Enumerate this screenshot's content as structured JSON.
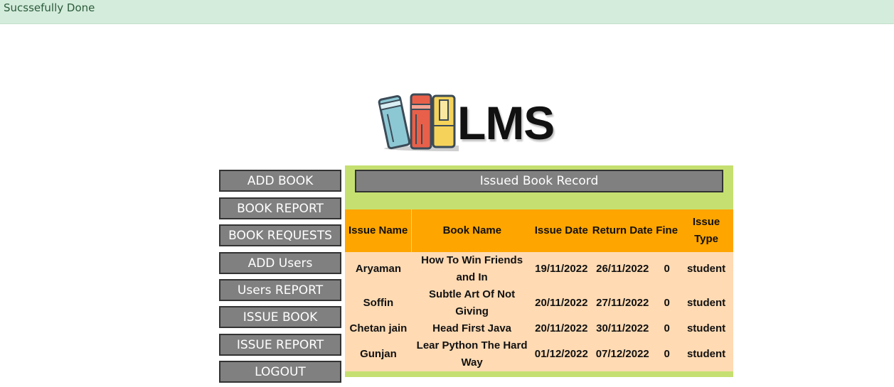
{
  "alert": {
    "message": "Sucssefully Done"
  },
  "logo": {
    "text": "LMS"
  },
  "sidebar": {
    "items": [
      {
        "label": "ADD BOOK"
      },
      {
        "label": "BOOK REPORT"
      },
      {
        "label": "BOOK REQUESTS"
      },
      {
        "label": "ADD Users"
      },
      {
        "label": "Users REPORT"
      },
      {
        "label": "ISSUE BOOK"
      },
      {
        "label": "ISSUE REPORT"
      },
      {
        "label": "LOGOUT"
      }
    ]
  },
  "record": {
    "title": "Issued Book Record",
    "headers": [
      "Issue Name",
      "Book Name",
      "Issue Date",
      "Return Date",
      "Fine",
      "Issue Type"
    ],
    "rows": [
      [
        "Aryaman",
        "How To Win Friends and In",
        "19/11/2022",
        "26/11/2022",
        "0",
        "student"
      ],
      [
        "Soffin",
        "Subtle Art Of Not Giving",
        "20/11/2022",
        "27/11/2022",
        "0",
        "student"
      ],
      [
        "Chetan jain",
        "Head First Java",
        "20/11/2022",
        "30/11/2022",
        "0",
        "student"
      ],
      [
        "Gunjan",
        "Lear Python The Hard Way",
        "01/12/2022",
        "07/12/2022",
        "0",
        "student"
      ]
    ]
  },
  "colors": {
    "alert_bg": "#d4ecdc",
    "panel_bg": "#c5e070",
    "header_bg": "#ffa500",
    "row_bg": "#ffdab3",
    "button_bg": "#808080"
  }
}
